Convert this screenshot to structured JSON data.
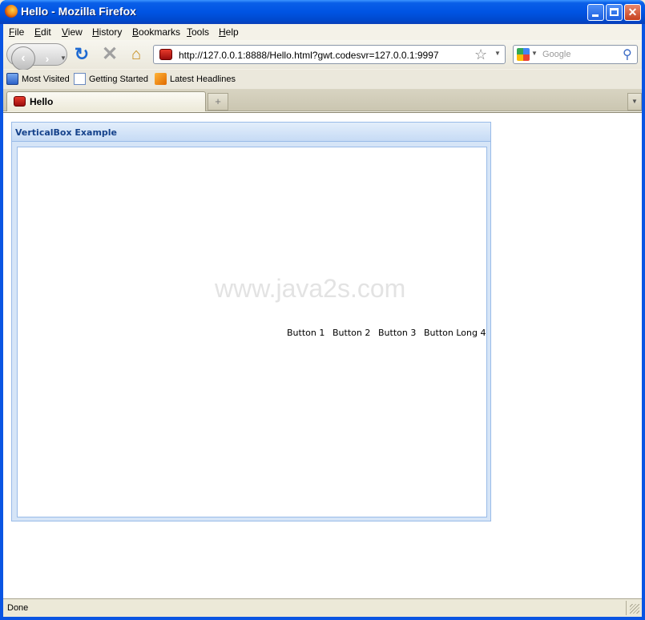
{
  "window": {
    "title": "Hello - Mozilla Firefox"
  },
  "menu": {
    "items": [
      {
        "accel": "F",
        "rest": "ile"
      },
      {
        "accel": "E",
        "rest": "dit"
      },
      {
        "accel": "V",
        "rest": "iew"
      },
      {
        "accel": "H",
        "rest": "istory"
      },
      {
        "accel": "B",
        "rest": "ookmarks"
      },
      {
        "accel": "T",
        "rest": "ools"
      },
      {
        "accel": "H",
        "rest": "elp"
      }
    ]
  },
  "nav": {
    "url": "http://127.0.0.1:8888/Hello.html?gwt.codesvr=127.0.0.1:9997",
    "search_placeholder": "Google"
  },
  "bookmarks": {
    "items": [
      "Most Visited",
      "Getting Started",
      "Latest Headlines"
    ]
  },
  "tabs": {
    "active_label": "Hello",
    "new_tab_glyph": "+"
  },
  "panel": {
    "title": "VerticalBox Example",
    "watermark": "www.java2s.com",
    "buttons": [
      "Button 1",
      "Button 2",
      "Button 3",
      "Button Long 4"
    ]
  },
  "status": {
    "text": "Done"
  },
  "colors": {
    "titlebar": "#0054e3",
    "panel_header_text": "#15428b",
    "panel_border": "#99bbe8"
  },
  "icons": [
    "firefox-icon",
    "minimize-icon",
    "maximize-icon",
    "close-icon",
    "back-arrow-icon",
    "forward-arrow-icon",
    "history-dropdown-icon",
    "reload-icon",
    "stop-icon",
    "home-icon",
    "site-favicon-icon",
    "bookmark-star-icon",
    "url-dropdown-icon",
    "google-engine-icon",
    "search-engine-dropdown-icon",
    "search-magnifier-icon",
    "most-visited-icon",
    "page-icon",
    "rss-feed-icon",
    "tab-list-dropdown-icon",
    "resize-grip-icon"
  ]
}
